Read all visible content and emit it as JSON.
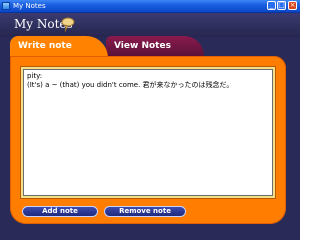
{
  "window": {
    "title": "My Notes",
    "icon": "app-icon",
    "controls": {
      "minimize": "_",
      "maximize": "□",
      "close": "×"
    }
  },
  "app": {
    "title": "My Notes",
    "logo_icon": "pin-icon"
  },
  "tabs": [
    {
      "label": "Write note",
      "active": true
    },
    {
      "label": "View Notes",
      "active": false
    }
  ],
  "editor": {
    "lines": [
      "pity:",
      "(It's) a ~ (that) you didn't come. 君が来なかったのは残念だ。"
    ]
  },
  "buttons": {
    "add": "Add note",
    "remove": "Remove note"
  },
  "colors": {
    "active_tab": "#ff8300",
    "inactive_tab": "#7a1745",
    "panel": "#ff7d00",
    "background": "#2a2a58",
    "button": "#2b389c"
  }
}
